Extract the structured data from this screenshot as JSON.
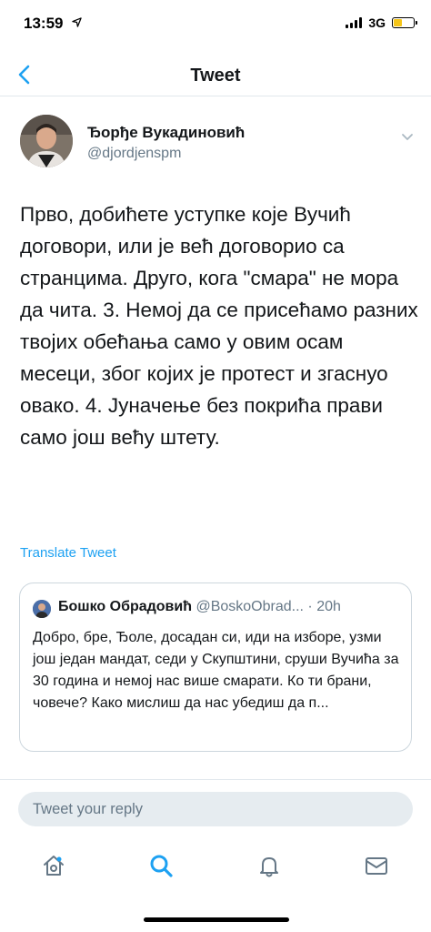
{
  "status_bar": {
    "time": "13:59",
    "location_icon": "location-arrow-icon",
    "network": "3G",
    "battery_color": "#f5c518"
  },
  "nav": {
    "back_icon": "chevron-left-icon",
    "title": "Tweet"
  },
  "tweet": {
    "author_name": "Ђорђе Вукадиновић",
    "author_handle": "@djordjenspm",
    "text": "Прво, добићете уступке које Вучић договори, или је већ договорио са странцима. Друго, кога \"смара\" не мора да чита. 3. Немој да се присећамо разних твојих обећања само у овим осам месеци, због којих је протест и згаснуо овако. 4. Јуначење без покрића прави само још већу штету.",
    "translate_label": "Translate Tweet",
    "quoted": {
      "author_name": "Бошко Обрадовић",
      "author_handle": "@BoskoObrad...",
      "time": "· 20h",
      "text": "Добро, бре, Ђоле, досадан си, иди на изборе, узми још један мандат, седи у Скупштини, сруши Вучића за 30 година и немој нас више смарати. Ко ти брани, човече? Како мислиш да нас убедиш да п..."
    }
  },
  "reply": {
    "placeholder": "Tweet your reply"
  },
  "tab_bar": {
    "items": [
      {
        "icon": "home-icon",
        "active": false
      },
      {
        "icon": "search-icon",
        "active": true
      },
      {
        "icon": "bell-icon",
        "active": false
      },
      {
        "icon": "mail-icon",
        "active": false
      }
    ]
  },
  "colors": {
    "accent": "#1da1f2",
    "text": "#14171a",
    "secondary": "#657786",
    "border": "#e1e8ed"
  }
}
